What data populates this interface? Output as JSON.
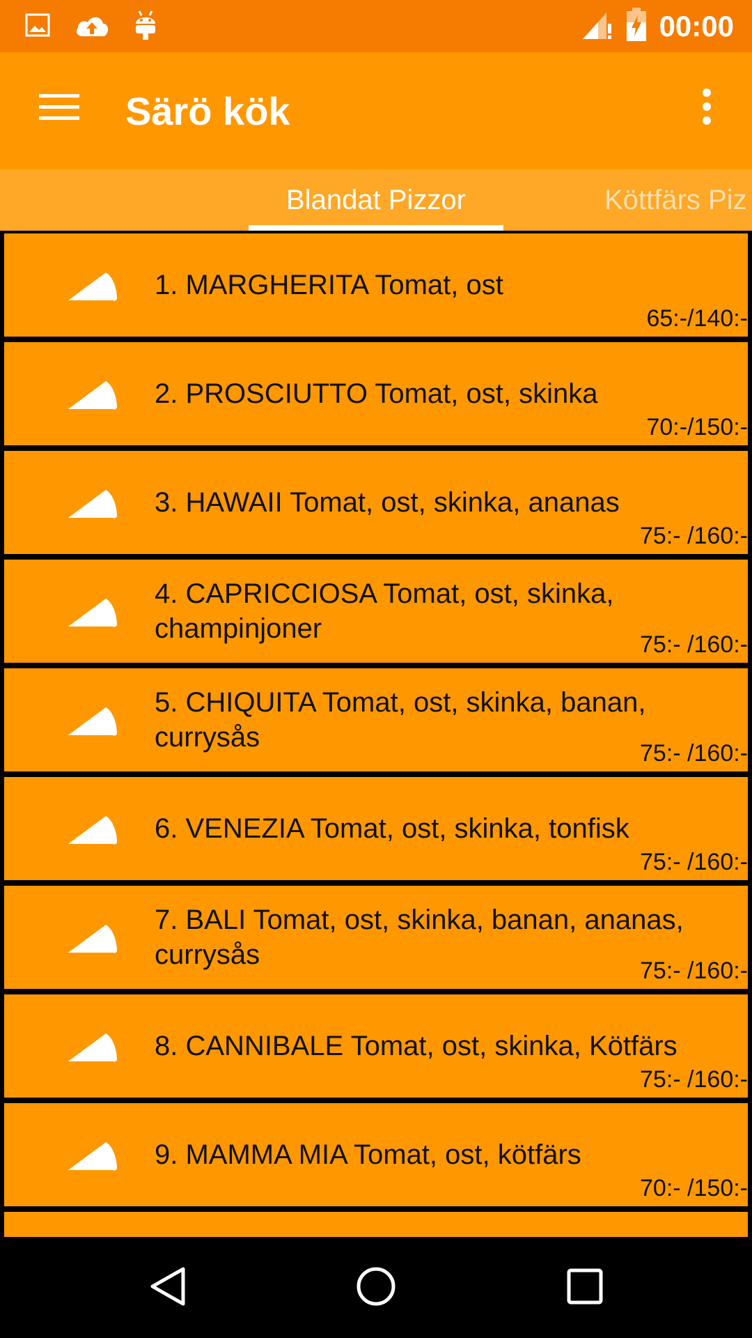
{
  "status_bar": {
    "time": "00:00",
    "icons": [
      "image-icon",
      "cloud-upload-icon",
      "android-icon",
      "signal-icon",
      "battery-charging-icon"
    ]
  },
  "app_bar": {
    "title": "Särö kök",
    "menu_icon": "hamburger-menu-icon",
    "overflow_icon": "more-vert-icon"
  },
  "tabs": [
    {
      "label": "Blandat Pizzor",
      "active": true
    },
    {
      "label": "Köttfärs Piz",
      "active": false
    }
  ],
  "menu_items": [
    {
      "name": "1. MARGHERITA Tomat, ost",
      "price": "65:-/140:-"
    },
    {
      "name": "2. PROSCIUTTO Tomat, ost, skinka",
      "price": "70:-/150:-"
    },
    {
      "name": "3. HAWAII Tomat, ost, skinka, ananas",
      "price": "75:- /160:-"
    },
    {
      "name": "4. CAPRICCIOSA Tomat, ost, skinka, champinjoner",
      "price": "75:- /160:-"
    },
    {
      "name": "5. CHIQUITA Tomat, ost, skinka, banan, currysås",
      "price": "75:- /160:-"
    },
    {
      "name": "6. VENEZIA Tomat, ost, skinka, tonfisk",
      "price": "75:- /160:-"
    },
    {
      "name": "7. BALI Tomat, ost, skinka, banan, ananas, currysås",
      "price": "75:- /160:-"
    },
    {
      "name": "8. CANNIBALE Tomat, ost, skinka, Kötfärs",
      "price": "75:- /160:-"
    },
    {
      "name": "9. MAMMA MIA Tomat, ost, kötfärs",
      "price": "70:- /150:-"
    }
  ],
  "nav_bar": {
    "icons": [
      "back-icon",
      "home-icon",
      "recents-icon"
    ]
  },
  "colors": {
    "status_bar": "#F57C00",
    "primary": "#FF9800",
    "tab_bar": "#FFA726",
    "divider": "#000000"
  }
}
